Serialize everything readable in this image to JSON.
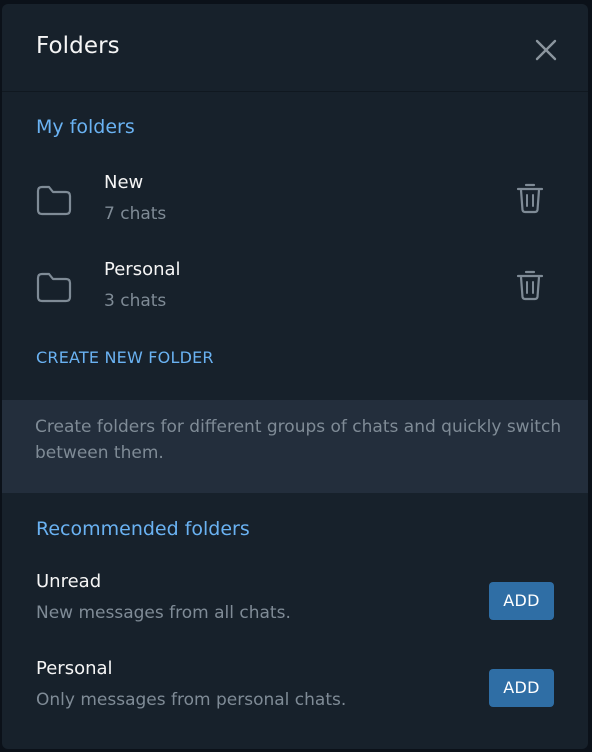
{
  "dialog": {
    "title": "Folders",
    "close_icon": "close-icon"
  },
  "my_folders": {
    "section_title": "My folders",
    "items": [
      {
        "name": "New",
        "count": "7 chats",
        "icon": "folder-icon",
        "delete_icon": "trash-icon"
      },
      {
        "name": "Personal",
        "count": "3 chats",
        "icon": "folder-icon",
        "delete_icon": "trash-icon"
      }
    ],
    "create_label": "CREATE NEW FOLDER",
    "info_text": "Create folders for different groups of chats and quickly switch between them."
  },
  "recommended": {
    "section_title": "Recommended folders",
    "items": [
      {
        "name": "Unread",
        "description": "New messages from all chats.",
        "button_label": "ADD"
      },
      {
        "name": "Personal",
        "description": "Only messages from personal chats.",
        "button_label": "ADD"
      }
    ]
  },
  "colors": {
    "background": "#17212b",
    "accent": "#6ab2f2",
    "button": "#2f6ea5",
    "muted_text": "#7f8b96",
    "info_background": "#232e3c"
  }
}
